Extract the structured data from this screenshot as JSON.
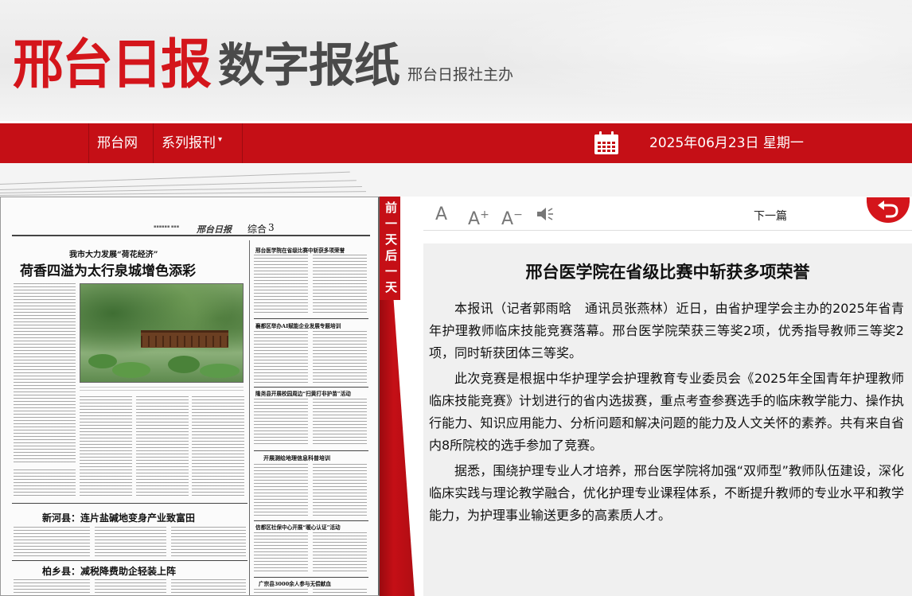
{
  "header": {
    "logo_red": "邢台日报",
    "logo_gray": "数字报纸",
    "logo_sub": "邢台日报社主办"
  },
  "nav": {
    "items": [
      {
        "label": "邢台网"
      },
      {
        "label": "系列报刊"
      }
    ],
    "caret": "▾",
    "date": "2025年06月23日 星期一"
  },
  "sidetab": {
    "label": "前一天后一天"
  },
  "toolbar": {
    "font_default": "A",
    "font_increase": "A",
    "font_increase_sign": "+",
    "font_decrease": "A",
    "font_decrease_sign": "−",
    "next_label": "下一篇"
  },
  "article": {
    "title": "邢台医学院在省级比赛中斩获多项荣誉",
    "paragraphs": [
      "本报讯（记者郭雨晗　通讯员张燕林）近日，由省护理学会主办的2025年省青年护理教师临床技能竞赛落幕。邢台医学院荣获三等奖2项，优秀指导教师三等奖2项，同时斩获团体三等奖。",
      "此次竞赛是根据中华护理学会护理教育专业委员会《2025年全国青年护理教师临床技能竞赛》计划进行的省内选拔赛，重点考查参赛选手的临床教学能力、操作执行能力、知识应用能力、分析问题和解决问题的能力及人文关怀的素养。共有来自省内8所院校的选手参加了竞赛。",
      "据悉，围绕护理专业人才培养，邢台医学院将加强“双师型”教师队伍建设，深化临床实践与理论教学融合，优化护理专业课程体系，不断提升教师的专业水平和教学能力，为护理事业输送更多的高素质人才。"
    ]
  },
  "newspaper": {
    "masthead": "邢台日报",
    "section": "综合",
    "page_no": "3",
    "kicker": "我市大力发展“荷花经济”",
    "main_headline": "荷香四溢为太行泉城增色添彩",
    "story2_headline": "邢台医学院在省级比赛中斩获多项荣誉",
    "story3_headline": "襄都区举办AI赋能企业发展专题培训",
    "story4_headline": "隆尧县开展校园周边“扫黄打非护苗”活动",
    "story5_headline": "开展测绘地理信息科普培训",
    "headline_6": "新河县：连片盐碱地变身产业致富田",
    "headline_7": "柏乡县：减税降费助企轻装上阵",
    "story8_headline": "信都区社保中心开展“暖心认证”活动",
    "story9_headline": "广宗县3000余人参与无偿献血"
  },
  "colors": {
    "brand_red": "#c50f16",
    "logo_red": "#d4151b",
    "article_bg": "#f0f0f0"
  },
  "icons": {
    "calendar": "calendar-icon",
    "speaker": "speaker-icon",
    "back": "back-arrow-icon"
  }
}
